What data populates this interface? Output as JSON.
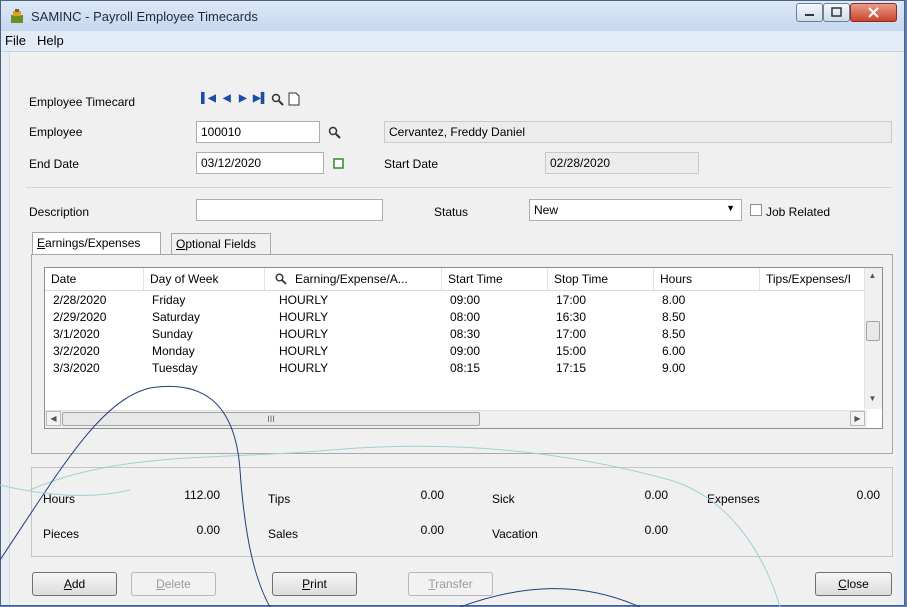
{
  "window": {
    "title": "SAMINC - Payroll Employee Timecards",
    "min_icon": "minimize-icon",
    "max_icon": "maximize-icon",
    "close_icon": "close-icon"
  },
  "menu": {
    "file": "File",
    "help": "Help"
  },
  "form": {
    "employee_timecard_label": "Employee Timecard",
    "employee_label": "Employee",
    "employee_value": "100010",
    "employee_name": "Cervantez, Freddy Daniel",
    "end_date_label": "End Date",
    "end_date_value": "03/12/2020",
    "start_date_label": "Start Date",
    "start_date_value": "02/28/2020",
    "description_label": "Description",
    "description_value": "",
    "status_label": "Status",
    "status_value": "New",
    "job_related_label": "Job Related"
  },
  "tabs": {
    "earnings_first": "E",
    "earnings_rest": "arnings/Expenses",
    "optional_first": "O",
    "optional_rest": "ptional Fields"
  },
  "grid": {
    "columns": [
      "Date",
      "Day of Week",
      "Earning/Expense/A...",
      "Start Time",
      "Stop Time",
      "Hours",
      "Tips/Expenses/I"
    ],
    "rows": [
      [
        "2/28/2020",
        "Friday",
        "HOURLY",
        "09:00",
        "17:00",
        "8.00",
        ""
      ],
      [
        "2/29/2020",
        "Saturday",
        "HOURLY",
        "08:00",
        "16:30",
        "8.50",
        ""
      ],
      [
        "3/1/2020",
        "Sunday",
        "HOURLY",
        "08:30",
        "17:00",
        "8.50",
        ""
      ],
      [
        "3/2/2020",
        "Monday",
        "HOURLY",
        "09:00",
        "15:00",
        "6.00",
        ""
      ],
      [
        "3/3/2020",
        "Tuesday",
        "HOURLY",
        "08:15",
        "17:15",
        "9.00",
        ""
      ]
    ],
    "hscroll_mark": "III"
  },
  "totals": {
    "hours_label": "Hours",
    "hours_value": "112.00",
    "pieces_label": "Pieces",
    "pieces_value": "0.00",
    "tips_label": "Tips",
    "tips_value": "0.00",
    "sales_label": "Sales",
    "sales_value": "0.00",
    "sick_label": "Sick",
    "sick_value": "0.00",
    "vacation_label": "Vacation",
    "vacation_value": "0.00",
    "expenses_label": "Expenses",
    "expenses_value": "0.00"
  },
  "buttons": {
    "add_first": "A",
    "add_rest": "dd",
    "delete_first": "D",
    "delete_rest": "elete",
    "print_first": "P",
    "print_rest": "rint",
    "transfer_first": "T",
    "transfer_rest": "ransfer",
    "close_first": "C",
    "close_rest": "lose"
  },
  "colors": {
    "accent": "#1d4da3",
    "window_frame": "#4a6383",
    "titlebar": "#c5d8ee",
    "close_button": "#c8452f"
  }
}
